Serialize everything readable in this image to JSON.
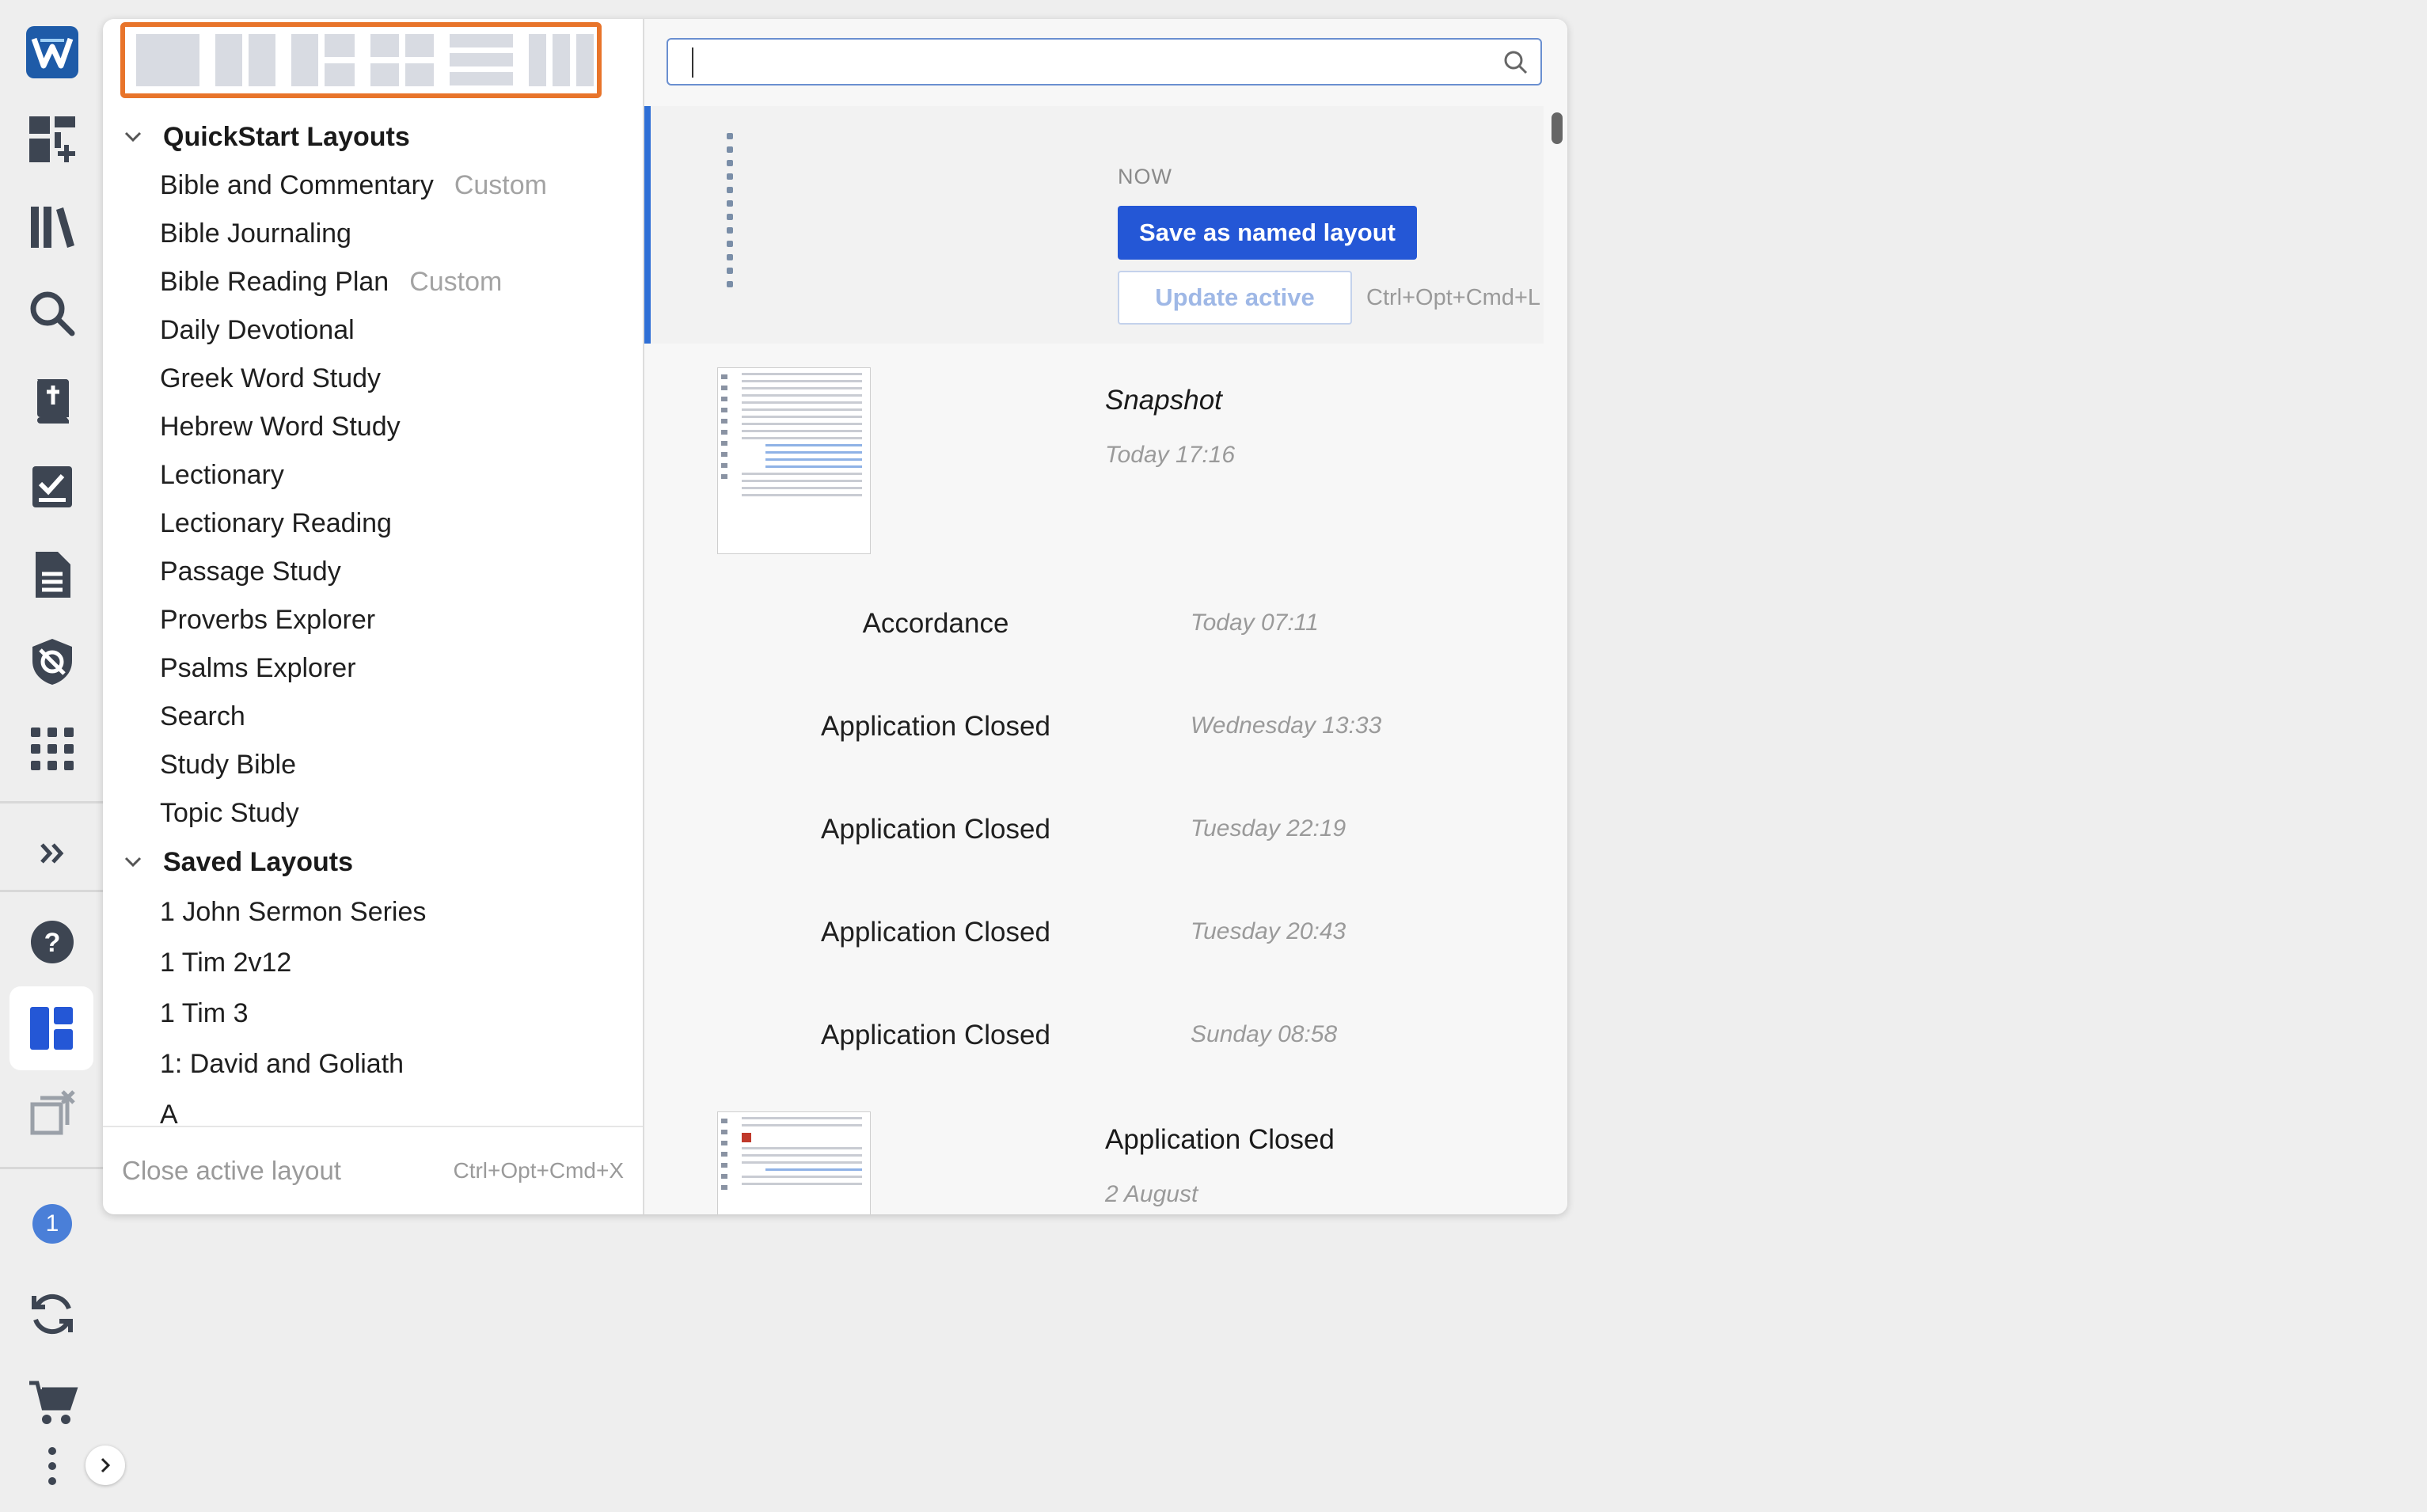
{
  "app": {
    "brand_icon": "app-logo-icon"
  },
  "rail": {
    "icons": [
      "add-panel-icon",
      "library-icon",
      "search-icon",
      "bible-icon",
      "tasks-icon",
      "document-icon",
      "shield-eye-icon",
      "apps-grid-icon"
    ],
    "badge_count": "1"
  },
  "left_pane": {
    "groups": [
      {
        "label": "QuickStart Layouts",
        "items": [
          {
            "label": "Bible and Commentary",
            "tag": "Custom"
          },
          {
            "label": "Bible Journaling",
            "tag": ""
          },
          {
            "label": "Bible Reading Plan",
            "tag": "Custom"
          },
          {
            "label": "Daily Devotional",
            "tag": ""
          },
          {
            "label": "Greek Word Study",
            "tag": ""
          },
          {
            "label": "Hebrew Word Study",
            "tag": ""
          },
          {
            "label": "Lectionary",
            "tag": ""
          },
          {
            "label": "Lectionary Reading",
            "tag": ""
          },
          {
            "label": "Passage Study",
            "tag": ""
          },
          {
            "label": "Proverbs Explorer",
            "tag": ""
          },
          {
            "label": "Psalms Explorer",
            "tag": ""
          },
          {
            "label": "Search",
            "tag": ""
          },
          {
            "label": "Study Bible",
            "tag": ""
          },
          {
            "label": "Topic Study",
            "tag": ""
          }
        ]
      },
      {
        "label": "Saved Layouts",
        "items": [
          {
            "label": "1 John Sermon Series",
            "tag": ""
          },
          {
            "label": "1 Tim 2v12",
            "tag": ""
          },
          {
            "label": "1 Tim 3",
            "tag": ""
          },
          {
            "label": "1: David and Goliath",
            "tag": ""
          },
          {
            "label": "A",
            "tag": ""
          }
        ]
      }
    ],
    "footer": {
      "close_label": "Close active layout",
      "close_shortcut": "Ctrl+Opt+Cmd+X"
    }
  },
  "right_pane": {
    "search": {
      "value": "",
      "placeholder": ""
    },
    "now": {
      "label": "NOW",
      "save_button": "Save as named layout",
      "update_button": "Update active",
      "update_shortcut": "Ctrl+Opt+Cmd+L"
    },
    "snapshot": {
      "title": "Snapshot",
      "time": "Today 17:16"
    },
    "history": [
      {
        "name": "Accordance",
        "time": "Today 07:11"
      },
      {
        "name": "Application Closed",
        "time": "Wednesday 13:33"
      },
      {
        "name": "Application Closed",
        "time": "Tuesday 22:19"
      },
      {
        "name": "Application Closed",
        "time": "Tuesday 20:43"
      },
      {
        "name": "Application Closed",
        "time": "Sunday 08:58"
      }
    ],
    "last_snapshot": {
      "title": "Application Closed",
      "time": "2 August"
    }
  },
  "colors": {
    "accent": "#2457d6",
    "highlight_border": "#e8742a",
    "background": "#eeeeee"
  }
}
